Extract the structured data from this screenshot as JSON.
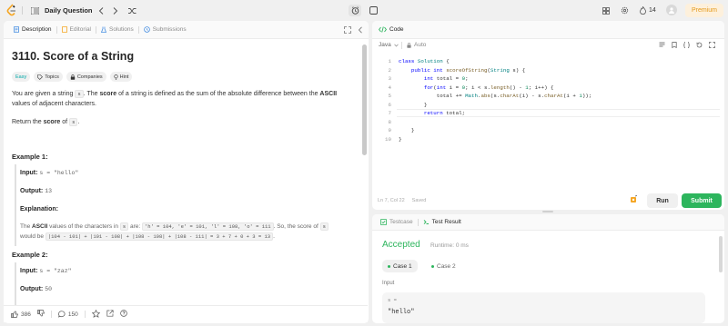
{
  "topbar": {
    "problem_list_label": "Daily Question",
    "streak_count": "14",
    "premium_label": "Premium"
  },
  "left_tabs": [
    {
      "label": "Description",
      "icon": "document-icon"
    },
    {
      "label": "Editorial",
      "icon": "book-icon"
    },
    {
      "label": "Solutions",
      "icon": "flask-icon"
    },
    {
      "label": "Submissions",
      "icon": "history-icon"
    }
  ],
  "problem": {
    "title": "3110. Score of a String",
    "difficulty": "Easy",
    "topics_label": "Topics",
    "companies_label": "Companies",
    "hint_label": "Hint",
    "desc_p1_a": "You are given a string ",
    "desc_p1_code": "s",
    "desc_p1_b": ". The ",
    "desc_p1_bold1": "score",
    "desc_p1_c": " of a string is defined as the sum of the absolute difference between the ",
    "desc_p1_bold2": "ASCII",
    "desc_p1_line2": "values of adjacent characters.",
    "desc_p2_a": "Return the ",
    "desc_p2_bold": "score",
    "desc_p2_b": " of ",
    "desc_p2_code": "s",
    "desc_p2_c": "."
  },
  "examples": [
    {
      "title": "Example 1:",
      "input_label": "Input:",
      "input_value": "s = \"hello\"",
      "output_label": "Output:",
      "output_value": "13",
      "explanation_label": "Explanation:",
      "expl_a": "The ",
      "expl_bold": "ASCII",
      "expl_b": " values of the characters in ",
      "expl_code_s": "s",
      "expl_c": " are: ",
      "expl_vals": "'h' = 104, 'e' = 101, 'l' = 108, 'o' = 111",
      "expl_d": ". So, the score of ",
      "expl_code_s2": "s",
      "expl_e": "would be ",
      "expl_formula": "|104 - 101| + |101 - 108| + |108 - 108| + |108 - 111| = 3 + 7 + 0 + 3 = 13",
      "expl_f": "."
    },
    {
      "title": "Example 2:",
      "input_label": "Input:",
      "input_value": "s = \"zaz\"",
      "output_label": "Output:",
      "output_value": "50"
    }
  ],
  "footer": {
    "likes": "386",
    "comments": "150"
  },
  "code_panel": {
    "title": "Code",
    "language": "Java",
    "autosave": "Auto",
    "status": "Ln 7, Col 22",
    "saved": "Saved",
    "run_label": "Run",
    "submit_label": "Submit",
    "line_numbers": [
      "1",
      "2",
      "3",
      "4",
      "5",
      "6",
      "7",
      "8",
      "9",
      "10"
    ]
  },
  "result_panel": {
    "testcase_tab": "Testcase",
    "result_tab": "Test Result",
    "verdict": "Accepted",
    "runtime": "Runtime: 0 ms",
    "case1": "Case 1",
    "case2": "Case 2",
    "input_label": "Input",
    "var_label": "s =",
    "var_value": "\"hello\""
  },
  "colors": {
    "accent_green": "#2db55d",
    "easy": "#00a8a8",
    "premium_bg": "#fdf0dc",
    "premium_text": "#e59a1b"
  }
}
